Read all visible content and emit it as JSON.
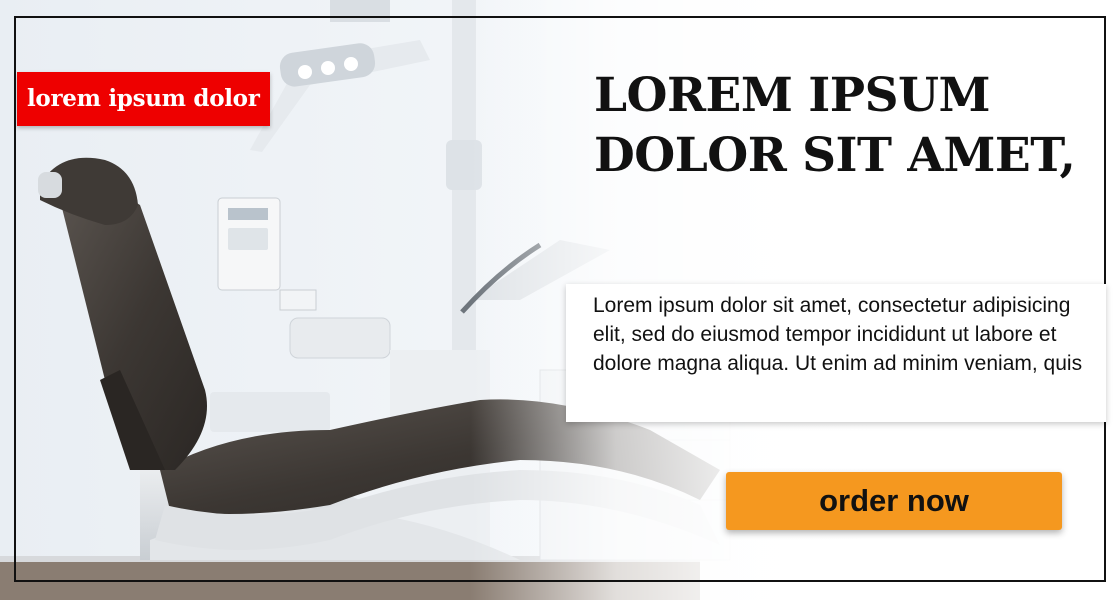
{
  "banner": {
    "tag_label": "lorem ipsum dolor",
    "headline": "LOREM IPSUM DOLOR SIT AMET,",
    "description": "Lorem ipsum dolor sit amet, consectetur adipisicing elit, sed do eiusmod tempor incididunt ut labore et dolore magna aliqua. Ut enim ad minim veniam, quis",
    "cta_label": "order now"
  },
  "colors": {
    "tag_background": "#ee0000",
    "cta_background": "#f5981f",
    "text": "#111111",
    "frame": "#111111"
  }
}
